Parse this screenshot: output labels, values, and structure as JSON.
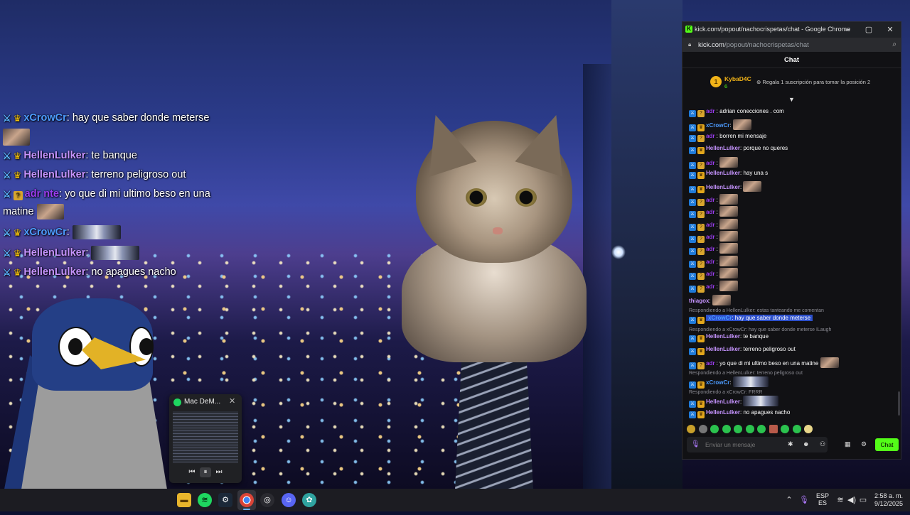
{
  "overlay_chat": [
    {
      "badges": [
        "mod",
        "crown"
      ],
      "user": "xCrowCr",
      "text": "hay que saber donde meterse"
    },
    {
      "badges": [
        "mod",
        "crown"
      ],
      "user": "HellenLulker",
      "text": "te banque"
    },
    {
      "badges": [
        "mod",
        "crown"
      ],
      "user": "HellenLulker",
      "text": "terreno peligroso out"
    },
    {
      "badges": [
        "mod",
        "sub"
      ],
      "user": "adr      nte",
      "text": "yo que di mi ultimo beso en una",
      "text2": "matine"
    },
    {
      "badges": [
        "mod",
        "crown"
      ],
      "user": "xCrowCr",
      "text": ""
    },
    {
      "badges": [
        "mod",
        "crown"
      ],
      "user": "HellenLulker",
      "text": ""
    },
    {
      "badges": [
        "mod",
        "crown"
      ],
      "user": "HellenLulker",
      "text": "no apagues nacho"
    }
  ],
  "spotify": {
    "title": "Mac DeM...",
    "close": "✕",
    "prev": "⏮",
    "play": "⏸",
    "next": "⏭"
  },
  "browser": {
    "title": "kick.com/popout/nachocrispetas/chat - Google Chrome",
    "url_host": "kick.com",
    "url_path": "/popout/nachocrispetas/chat",
    "minimize": "–",
    "maximize": "▢",
    "close": "✕"
  },
  "chat": {
    "header": "Chat",
    "pinned": {
      "rank": "1",
      "name": "KybaD4C",
      "count": "6",
      "gift": "Regala 1 suscripción para tomar la posición 2"
    },
    "messages": [
      {
        "user": "adr      ",
        "text": "adrian conecciones . com",
        "emote": false
      },
      {
        "user": "xCrowCr",
        "text": "",
        "emote": true
      },
      {
        "user": "adr      ",
        "text": "borren mi mensaje",
        "emote": false
      },
      {
        "user": "HellenLulker",
        "text": "porque no queres",
        "emote": false
      },
      {
        "user": "adr      ",
        "text": "",
        "emote": true
      },
      {
        "user": "HellenLulker",
        "text": "hay una s",
        "emote": false
      },
      {
        "user": "HellenLulker",
        "text": "",
        "emote": true
      },
      {
        "user": "adr      ",
        "text": "",
        "emote": true
      },
      {
        "user": "adr      ",
        "text": "",
        "emote": true
      },
      {
        "user": "adr      ",
        "text": "",
        "emote": true
      },
      {
        "user": "adr      ",
        "text": "",
        "emote": true
      },
      {
        "user": "adr      ",
        "text": "",
        "emote": true
      },
      {
        "user": "adr      ",
        "text": "",
        "emote": true
      },
      {
        "user": "adr      ",
        "text": "",
        "emote": true
      },
      {
        "user": "adr      ",
        "text": "",
        "emote": true
      }
    ],
    "thiago": {
      "user": "thiagox",
      "text": ""
    },
    "reply1": "Respondiendo a HellenLulker: estas tanteando me comentan",
    "msg_highlight": {
      "user": "xCrowCr",
      "text": "hay que saber donde meterse"
    },
    "reply2": "Respondiendo a xCrowCr: hay que saber donde meterse ILaugh",
    "msg_banque": {
      "user": "HellenLulker",
      "text": "te banque"
    },
    "msg_terreno": {
      "user": "HellenLulker",
      "text": "terreno peligroso out"
    },
    "msg_beso": {
      "user": "adr      ",
      "text": "yo que di mi ultimo beso en una matine"
    },
    "reply3": "Respondiendo a HellenLulker: terreno peligroso out",
    "msg_crow2": {
      "user": "xCrowCr",
      "text": ""
    },
    "reply4": "Respondiendo a xCrowCr: FRRR",
    "msg_hellen2": {
      "user": "HellenLulker",
      "text": ""
    },
    "msg_apagues": {
      "user": "HellenLulker",
      "text": "no apagues nacho"
    },
    "input_placeholder": "Enviar un mensaje",
    "send_label": "Chat"
  },
  "taskbar": {
    "lang1": "ESP",
    "lang2": "ES",
    "time": "2:58 a. m.",
    "date": "9/12/2025"
  },
  "colors": {
    "kick_green": "#53fc18",
    "mod_blue": "#1f7ad8",
    "user_purple": "#c694ff",
    "crow_blue": "#4d9cff"
  }
}
